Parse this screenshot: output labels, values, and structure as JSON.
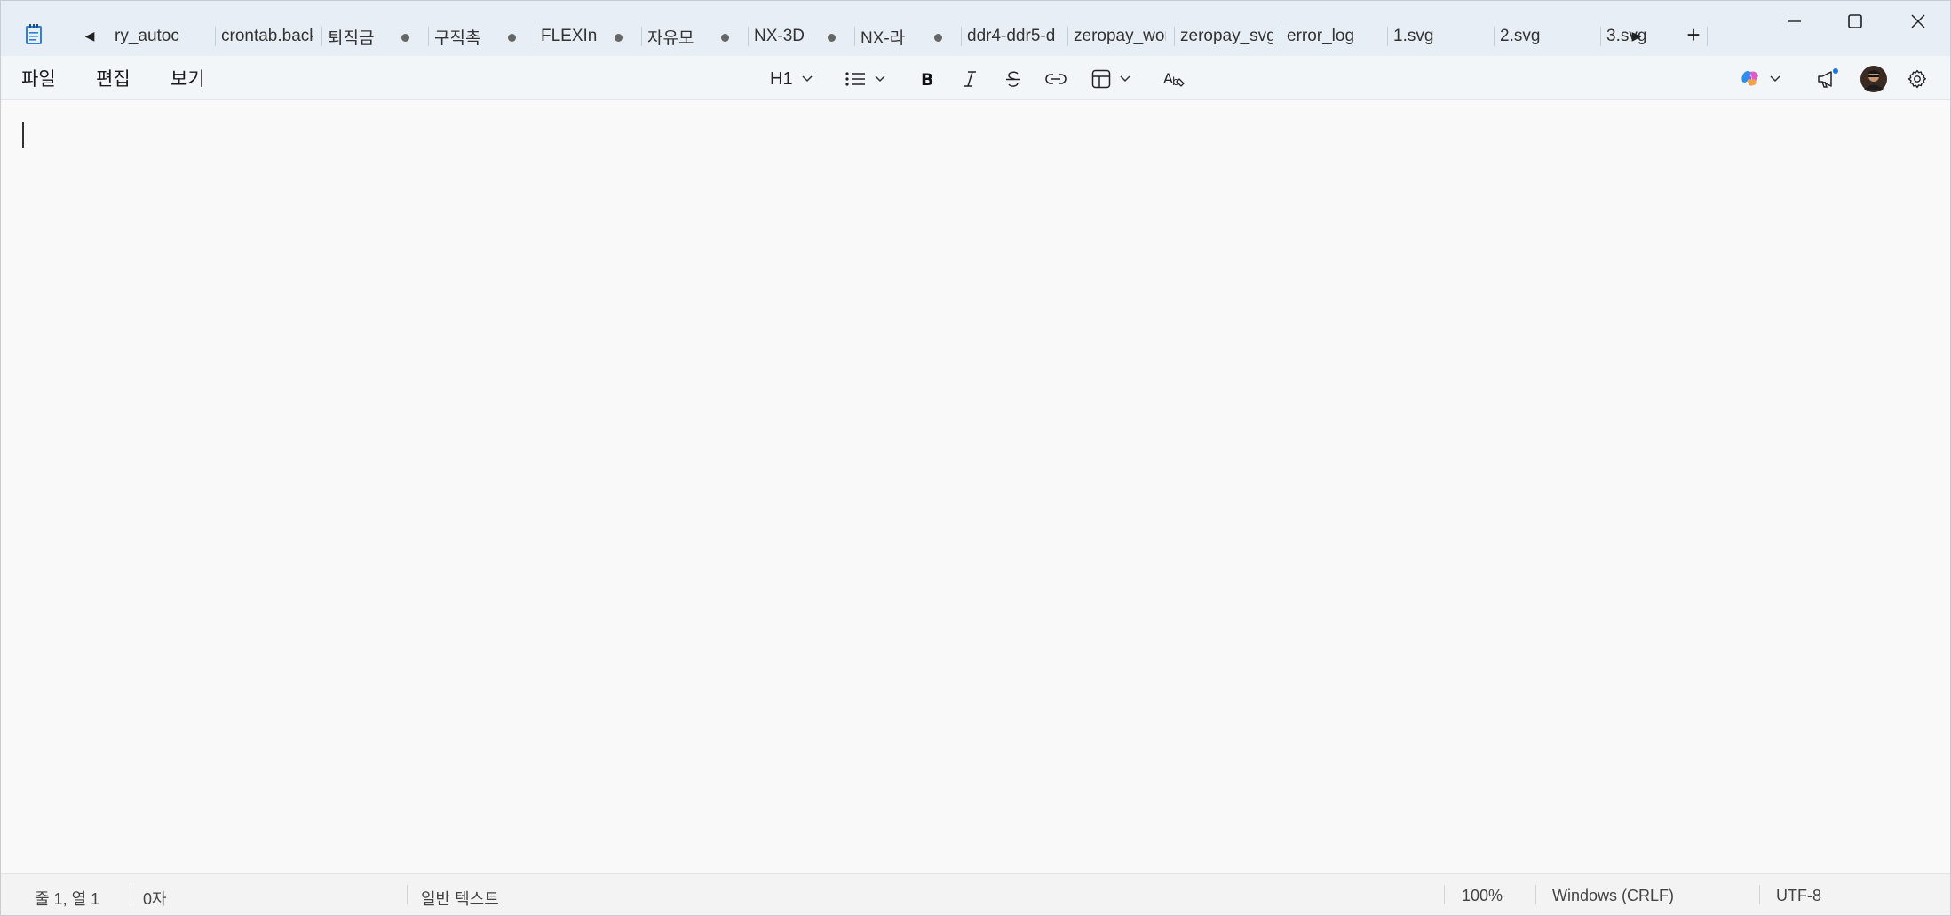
{
  "titlebar": {
    "tabs": [
      {
        "label": "ry_autoc",
        "modified": false
      },
      {
        "label": "crontab.back",
        "modified": false
      },
      {
        "label": "퇴직금",
        "modified": true
      },
      {
        "label": "구직촉",
        "modified": true
      },
      {
        "label": "FLEXIn",
        "modified": true
      },
      {
        "label": "자유모",
        "modified": true
      },
      {
        "label": "NX-3D",
        "modified": true
      },
      {
        "label": "NX-라",
        "modified": true
      },
      {
        "label": "ddr4-ddr5-d",
        "modified": false
      },
      {
        "label": "zeropay_wor",
        "modified": false
      },
      {
        "label": "zeropay_svg",
        "modified": false
      },
      {
        "label": "error_log",
        "modified": false
      },
      {
        "label": "1.svg",
        "modified": false
      },
      {
        "label": "2.svg",
        "modified": false
      },
      {
        "label": "3.svg",
        "modified": false
      }
    ],
    "scroll_left_icon": "◀",
    "scroll_right_icon": "▶",
    "new_tab_icon": "+"
  },
  "menu": {
    "file": "파일",
    "edit": "편집",
    "view": "보기"
  },
  "toolbar": {
    "heading": "H1"
  },
  "statusbar": {
    "position": "줄 1, 열 1",
    "char_count": "0자",
    "format": "일반 텍스트",
    "zoom": "100%",
    "line_ending": "Windows (CRLF)",
    "encoding": "UTF-8"
  },
  "colors": {
    "titlebar_bg": "#e8eef5",
    "editor_bg": "#f9f9f9",
    "notification_dot": "#1a73e8"
  }
}
